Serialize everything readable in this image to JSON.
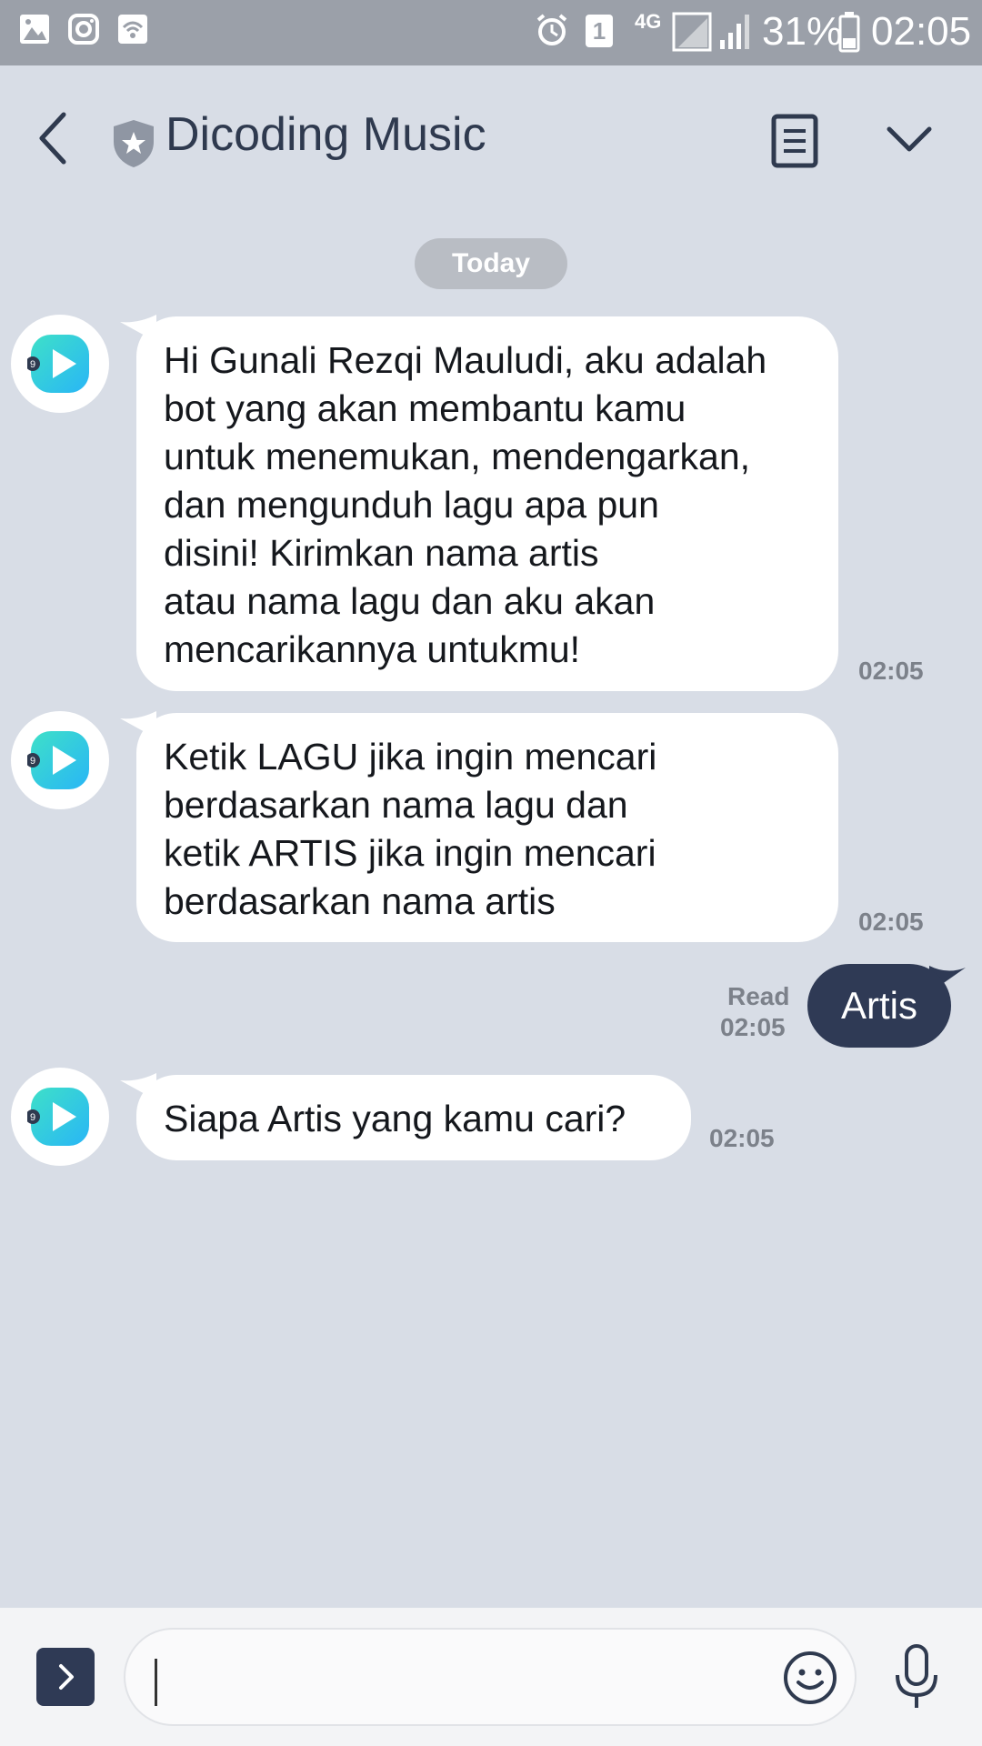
{
  "status_bar": {
    "battery": "31%",
    "time": "02:05",
    "sim_badge": "1",
    "network": "4G"
  },
  "header": {
    "title": "Dicoding Music"
  },
  "date_divider": "Today",
  "messages": [
    {
      "lines": [
        "Hi Gunali Rezqi Mauludi, aku adalah",
        "bot yang akan membantu kamu",
        "untuk menemukan, mendengarkan,",
        "dan mengunduh lagu apa pun",
        "disini! Kirimkan nama artis",
        "atau nama lagu dan aku akan",
        "mencarikannya untukmu!"
      ],
      "time": "02:05"
    },
    {
      "lines": [
        "Ketik LAGU jika ingin mencari",
        "berdasarkan nama lagu dan",
        "ketik ARTIS jika ingin mencari",
        "berdasarkan nama artis"
      ],
      "time": "02:05"
    },
    {
      "lines": [
        "Siapa Artis yang kamu cari?"
      ],
      "time": "02:05"
    }
  ],
  "outgoing": {
    "text": "Artis",
    "read_label": "Read",
    "time": "02:05"
  },
  "avatar_badge": "9",
  "colors": {
    "background": "#d8dde6",
    "outgoing_bubble": "#2f3a55",
    "status_bar": "#9ba0a9",
    "avatar_gradient_start": "#3ee0c8",
    "avatar_gradient_end": "#29b6f6"
  }
}
